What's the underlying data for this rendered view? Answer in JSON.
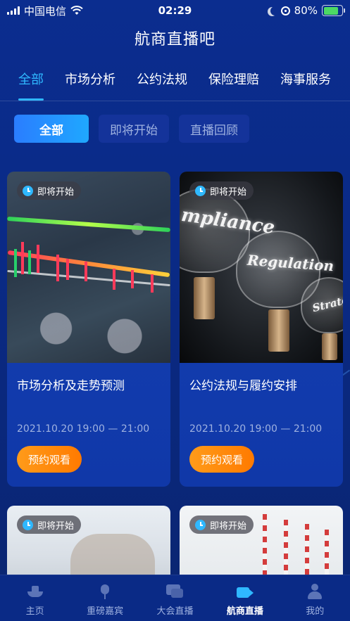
{
  "status_bar": {
    "carrier": "中国电信",
    "time": "02:29",
    "battery": "80%",
    "battery_level": 0.8
  },
  "header": {
    "title": "航商直播吧"
  },
  "top_tabs": [
    {
      "label": "全部",
      "active": true
    },
    {
      "label": "市场分析"
    },
    {
      "label": "公约法规"
    },
    {
      "label": "保险理赔"
    },
    {
      "label": "海事服务"
    }
  ],
  "filters": [
    {
      "label": "全部",
      "active": true
    },
    {
      "label": "即将开始"
    },
    {
      "label": "直播回顾"
    }
  ],
  "cards": [
    {
      "badge": "即将开始",
      "title": "市场分析及走势预测",
      "time": "2021.10.20 19:00 — 21:00",
      "button": "预约观看"
    },
    {
      "badge": "即将开始",
      "title": "公约法规与履约安排",
      "time": "2021.10.20 19:00 — 21:00",
      "button": "预约观看",
      "image_words": [
        "mpliance",
        "Regulation",
        "Strateg"
      ]
    },
    {
      "badge": "即将开始"
    },
    {
      "badge": "即将开始"
    }
  ],
  "tabbar": [
    {
      "label": "主页",
      "icon": "ship-icon"
    },
    {
      "label": "重磅嘉宾",
      "icon": "mic-icon"
    },
    {
      "label": "大会直播",
      "icon": "chat-icon"
    },
    {
      "label": "航商直播",
      "icon": "live-camera-icon",
      "active": true
    },
    {
      "label": "我的",
      "icon": "user-icon"
    }
  ],
  "colors": {
    "background": "#0b2d8f",
    "accent": "#2fb8ff",
    "button": "#ff8a00"
  }
}
